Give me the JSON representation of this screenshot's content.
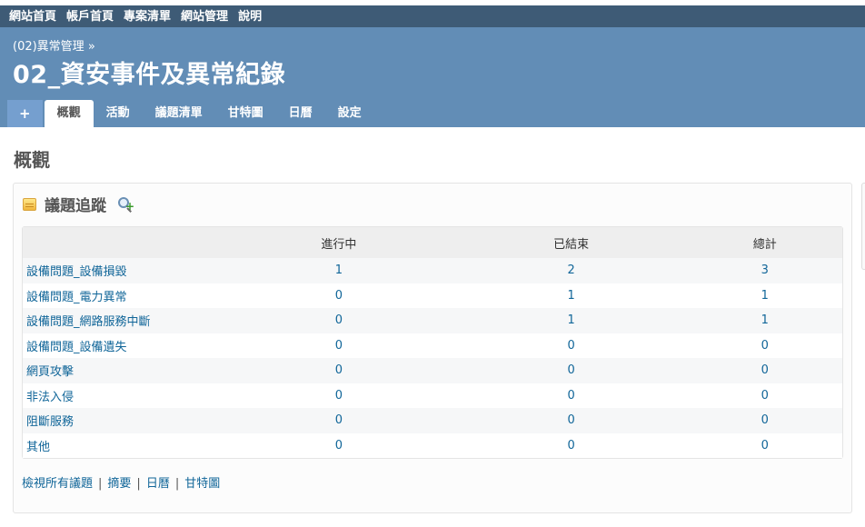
{
  "top_menu": {
    "items": [
      "網站首頁",
      "帳戶首頁",
      "專案清單",
      "網站管理",
      "說明"
    ]
  },
  "header": {
    "breadcrumb": "(02)異常管理 »",
    "title": "02_資安事件及異常紀錄"
  },
  "main_menu": {
    "new_label": "+",
    "tabs": [
      "概觀",
      "活動",
      "議題清單",
      "甘特圖",
      "日曆",
      "設定"
    ],
    "selected": "概觀"
  },
  "page_title": "概觀",
  "issue_tracking": {
    "title": "議題追蹤",
    "columns": [
      "",
      "進行中",
      "已結束",
      "總計"
    ],
    "rows": [
      {
        "name": "設備問題_設備損毀",
        "open": "1",
        "closed": "2",
        "total": "3"
      },
      {
        "name": "設備問題_電力異常",
        "open": "0",
        "closed": "1",
        "total": "1"
      },
      {
        "name": "設備問題_網路服務中斷",
        "open": "0",
        "closed": "1",
        "total": "1"
      },
      {
        "name": "設備問題_設備遺失",
        "open": "0",
        "closed": "0",
        "total": "0"
      },
      {
        "name": "網頁攻擊",
        "open": "0",
        "closed": "0",
        "total": "0"
      },
      {
        "name": "非法入侵",
        "open": "0",
        "closed": "0",
        "total": "0"
      },
      {
        "name": "阻斷服務",
        "open": "0",
        "closed": "0",
        "total": "0"
      },
      {
        "name": "其他",
        "open": "0",
        "closed": "0",
        "total": "0"
      }
    ],
    "links": [
      "檢視所有議題",
      "摘要",
      "日曆",
      "甘特圖"
    ],
    "separator": "|"
  },
  "colors": {
    "top_bar": "#3e5b76",
    "header": "#628db6",
    "link": "#116699"
  },
  "icons": {
    "section": "issues-icon",
    "query": "add-query-icon"
  }
}
